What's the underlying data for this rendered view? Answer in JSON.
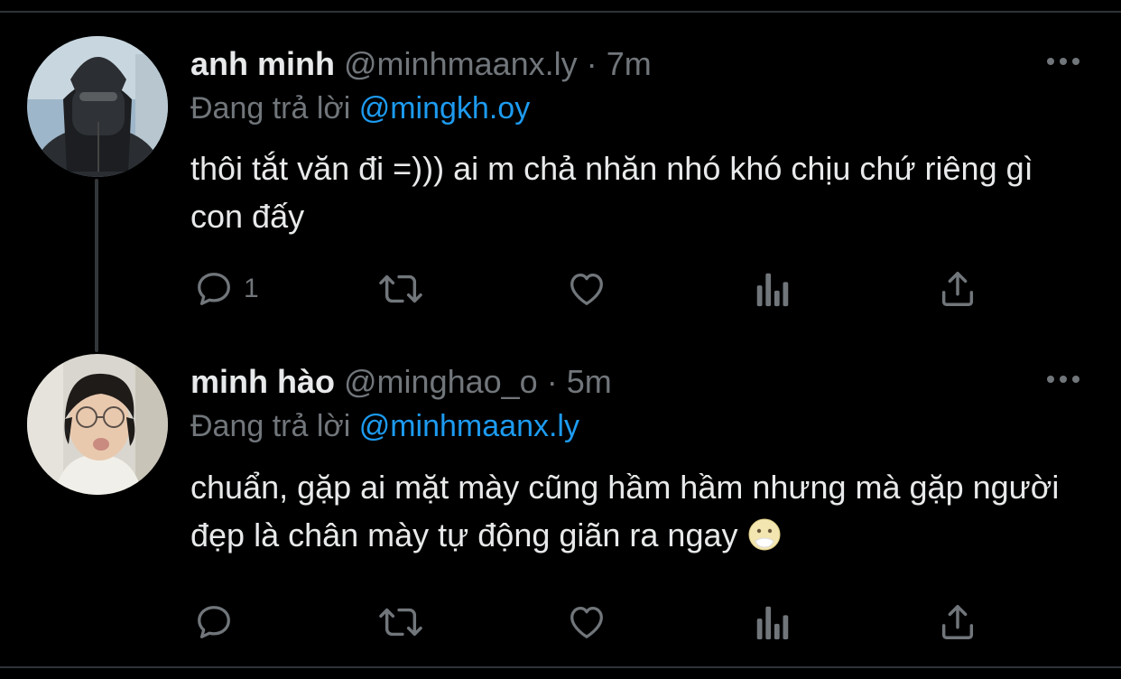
{
  "tweets": [
    {
      "display_name": "anh minh",
      "handle": "@minhmaanx.ly",
      "separator": "·",
      "time": "7m",
      "reply_prefix": "Đang trả lời",
      "reply_to": "@mingkh.oy",
      "text": "thôi tắt văn đi =))) ai m chả nhăn nhó khó chịu chứ riêng gì con đấy",
      "reply_count": "1"
    },
    {
      "display_name": "minh hào",
      "handle": "@minghao_o",
      "separator": "·",
      "time": "5m",
      "reply_prefix": "Đang trả lời",
      "reply_to": "@minhmaanx.ly",
      "text": "chuẩn, gặp ai mặt mày cũng hầm hầm nhưng mà gặp người đẹp là chân mày tự động giãn ra ngay",
      "emoji": "face-with-open-eyes-and-hand-over-mouth-icon",
      "reply_count": ""
    }
  ],
  "colors": {
    "background": "#000000",
    "text_primary": "#e7e9ea",
    "text_secondary": "#71767b",
    "link": "#1d9bf0",
    "divider": "#2f3336"
  }
}
